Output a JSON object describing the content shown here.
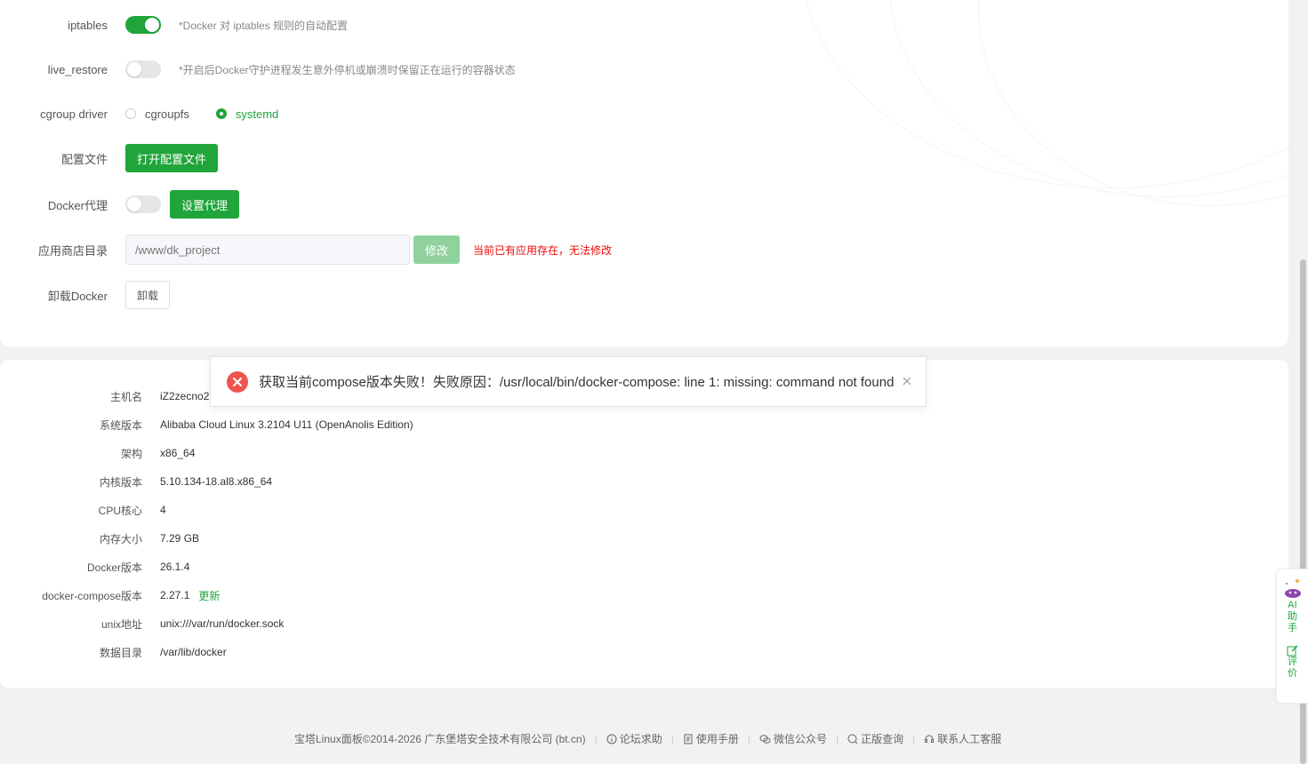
{
  "settings": {
    "iptables": {
      "label": "iptables",
      "enabled": true,
      "hint": "*Docker 对 iptables 规则的自动配置"
    },
    "live_restore": {
      "label": "live_restore",
      "enabled": false,
      "hint": "*开启后Docker守护进程发生意外停机或崩溃时保留正在运行的容器状态"
    },
    "cgroup": {
      "label": "cgroup driver",
      "options": [
        "cgroupfs",
        "systemd"
      ],
      "selected": "systemd"
    },
    "config": {
      "label": "配置文件",
      "button": "打开配置文件"
    },
    "proxy": {
      "label": "Docker代理",
      "enabled": false,
      "button": "设置代理"
    },
    "store_dir": {
      "label": "应用商店目录",
      "placeholder": "/www/dk_project",
      "button": "修改",
      "error": "当前已有应用存在，无法修改"
    },
    "uninstall": {
      "label": "卸载Docker",
      "button": "卸载"
    }
  },
  "info": {
    "rows": [
      {
        "label": "主机名",
        "value": "iZ2zecno2"
      },
      {
        "label": "系统版本",
        "value": "Alibaba Cloud Linux 3.2104 U11 (OpenAnolis Edition)"
      },
      {
        "label": "架构",
        "value": "x86_64"
      },
      {
        "label": "内核版本",
        "value": "5.10.134-18.al8.x86_64"
      },
      {
        "label": "CPU核心",
        "value": "4"
      },
      {
        "label": "内存大小",
        "value": "7.29 GB"
      },
      {
        "label": "Docker版本",
        "value": "26.1.4"
      },
      {
        "label": "docker-compose版本",
        "value": "2.27.1",
        "link": "更新"
      },
      {
        "label": "unix地址",
        "value": "unix:///var/run/docker.sock"
      },
      {
        "label": "数据目录",
        "value": "/var/lib/docker"
      }
    ]
  },
  "toast": {
    "message": "获取当前compose版本失败！失败原因：/usr/local/bin/docker-compose: line 1: missing: command not found"
  },
  "footer": {
    "copyright": "宝塔Linux面板©2014-2026 广东堡塔安全技术有限公司 (bt.cn)",
    "links": [
      "论坛求助",
      "使用手册",
      "微信公众号",
      "正版查询",
      "联系人工客服"
    ]
  },
  "ai_panel": {
    "assistant": "AI助手",
    "review": "评价"
  },
  "colors": {
    "accent": "#20a53a",
    "error": "#ef0808",
    "toast_icon": "#ef5350"
  }
}
